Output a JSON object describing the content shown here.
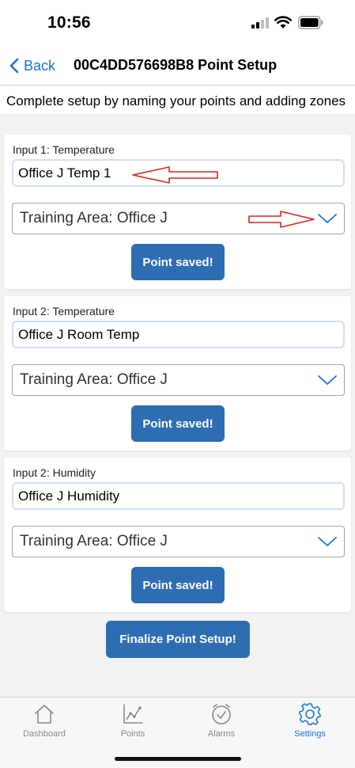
{
  "status_bar": {
    "time": "10:56"
  },
  "nav": {
    "back_label": "Back",
    "title": "00C4DD576698B8 Point Setup"
  },
  "intro_text": "Complete setup by naming your points and adding zones",
  "points": [
    {
      "label": "Input 1: Temperature",
      "name_value": "Office J Temp 1",
      "zone": "Training Area: Office J",
      "button_label": "Point saved!"
    },
    {
      "label": "Input 2: Temperature",
      "name_value": "Office J Room Temp",
      "zone": "Training Area: Office J",
      "button_label": "Point saved!"
    },
    {
      "label": "Input 2: Humidity",
      "name_value": "Office J Humidity",
      "zone": "Training Area: Office J",
      "button_label": "Point saved!"
    }
  ],
  "finalize_label": "Finalize Point Setup!",
  "tabs": [
    {
      "label": "Dashboard",
      "icon": "house-icon"
    },
    {
      "label": "Points",
      "icon": "chart-icon"
    },
    {
      "label": "Alarms",
      "icon": "clock-check-icon"
    },
    {
      "label": "Settings",
      "icon": "gear-icon",
      "active": true
    }
  ],
  "colors": {
    "accent": "#1a73d9",
    "button": "#2f6db3",
    "annotation_arrow": "#e02020"
  }
}
